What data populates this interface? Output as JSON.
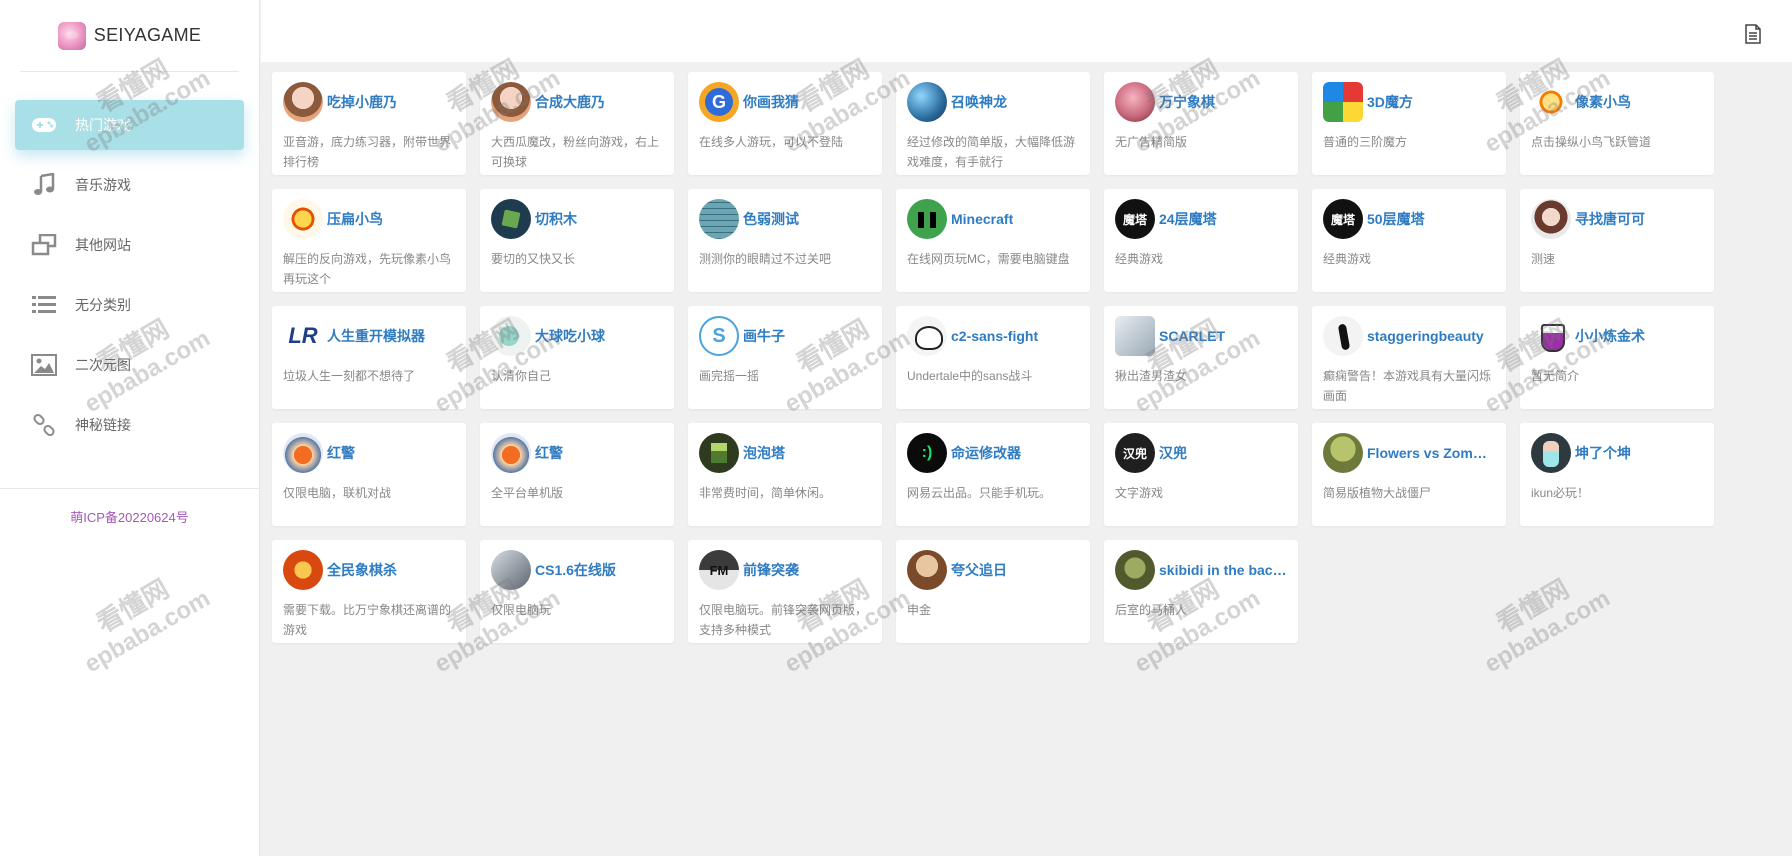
{
  "brand": {
    "name": "SEIYAGAME"
  },
  "menu": [
    {
      "label": "热门游戏",
      "icon": "gamepad-icon",
      "active": true
    },
    {
      "label": "音乐游戏",
      "icon": "music-note-icon",
      "active": false
    },
    {
      "label": "其他网站",
      "icon": "windows-icon",
      "active": false
    },
    {
      "label": "无分类别",
      "icon": "list-icon",
      "active": false
    },
    {
      "label": "二次元图",
      "icon": "image-icon",
      "active": false
    },
    {
      "label": "神秘链接",
      "icon": "link-icon",
      "active": false
    }
  ],
  "footer": {
    "icp": "萌ICP备20220624号"
  },
  "topbar": {
    "icon": "document-icon"
  },
  "cards": [
    {
      "title": "吃掉小鹿乃",
      "desc": "亚音游，底力练习器，附带世界排行榜",
      "avatar": "av-kid",
      "avatar_text": ""
    },
    {
      "title": "合成大鹿乃",
      "desc": "大西瓜魔改，粉丝向游戏，右上可换球",
      "avatar": "av-kid",
      "avatar_text": ""
    },
    {
      "title": "你画我猜",
      "desc": "在线多人游玩，可以不登陆",
      "avatar": "av-g",
      "avatar_text": "G"
    },
    {
      "title": "召唤神龙",
      "desc": "经过修改的简单版，大幅降低游戏难度，有手就行",
      "avatar": "av-dragon",
      "avatar_text": ""
    },
    {
      "title": "万宁象棋",
      "desc": "无广告精简版",
      "avatar": "av-chess",
      "avatar_text": ""
    },
    {
      "title": "3D魔方",
      "desc": "普通的三阶魔方",
      "avatar": "av-cube",
      "avatar_text": ""
    },
    {
      "title": "像素小鸟",
      "desc": "点击操纵小鸟飞跃管道",
      "avatar": "av-bird",
      "avatar_text": ""
    },
    {
      "title": "压扁小鸟",
      "desc": "解压的反向游戏，先玩像素小鸟再玩这个",
      "avatar": "av-bird2",
      "avatar_text": ""
    },
    {
      "title": "切积木",
      "desc": "要切的又快又长",
      "avatar": "av-cut",
      "avatar_text": ""
    },
    {
      "title": "色弱测试",
      "desc": "测测你的眼睛过不过关吧",
      "avatar": "av-grid",
      "avatar_text": ""
    },
    {
      "title": "Minecraft",
      "desc": "在线网页玩MC，需要电脑键盘",
      "avatar": "av-mc",
      "avatar_text": ""
    },
    {
      "title": "24层魔塔",
      "desc": "经典游戏",
      "avatar": "av-black",
      "avatar_text": "魔塔"
    },
    {
      "title": "50层魔塔",
      "desc": "经典游戏",
      "avatar": "av-black",
      "avatar_text": "魔塔"
    },
    {
      "title": "寻找唐可可",
      "desc": "测速",
      "avatar": "av-girl",
      "avatar_text": ""
    },
    {
      "title": "人生重开模拟器",
      "desc": "垃圾人生一刻都不想待了",
      "avatar": "av-lr",
      "avatar_text": "LR"
    },
    {
      "title": "大球吃小球",
      "desc": "认清你自己",
      "avatar": "av-ball",
      "avatar_text": ""
    },
    {
      "title": "画牛子",
      "desc": "画完摇一摇",
      "avatar": "av-s",
      "avatar_text": "S"
    },
    {
      "title": "c2-sans-fight",
      "desc": "Undertale中的sans战斗",
      "avatar": "av-sans",
      "avatar_text": ""
    },
    {
      "title": "SCARLET",
      "desc": "揪出渣男渣女",
      "avatar": "av-scarlet",
      "avatar_text": ""
    },
    {
      "title": "staggeringbeauty",
      "desc": "癫痫警告！本游戏具有大量闪烁画面",
      "avatar": "av-stag",
      "avatar_text": ""
    },
    {
      "title": "小小炼金术",
      "desc": "暂无简介",
      "avatar": "av-flask",
      "avatar_text": ""
    },
    {
      "title": "红警",
      "desc": "仅限电脑，联机对战",
      "avatar": "av-red",
      "avatar_text": ""
    },
    {
      "title": "红警",
      "desc": "全平台单机版",
      "avatar": "av-red",
      "avatar_text": ""
    },
    {
      "title": "泡泡塔",
      "desc": "非常费时间，简单休闲。",
      "avatar": "av-pixel",
      "avatar_text": ""
    },
    {
      "title": "命运修改器",
      "desc": "网易云出品。只能手机玩。",
      "avatar": "av-smile",
      "avatar_text": ":)"
    },
    {
      "title": "汉兜",
      "desc": "文字游戏",
      "avatar": "av-hanzi",
      "avatar_text": "汉兜"
    },
    {
      "title": "Flowers vs Zombies",
      "desc": "简易版植物大战僵尸",
      "avatar": "av-zombie",
      "avatar_text": ""
    },
    {
      "title": "坤了个坤",
      "desc": "ikun必玩！",
      "avatar": "av-kun",
      "avatar_text": ""
    },
    {
      "title": "全民象棋杀",
      "desc": "需要下载。比万宁象棋还离谱的游戏",
      "avatar": "av-poker",
      "avatar_text": ""
    },
    {
      "title": "CS1.6在线版",
      "desc": "仅限电脑玩",
      "avatar": "av-cs",
      "avatar_text": ""
    },
    {
      "title": "前锋突袭",
      "desc": "仅限电脑玩。前锋突袭网页版，支持多种模式",
      "avatar": "av-front",
      "avatar_text": "FM"
    },
    {
      "title": "夸父追日",
      "desc": "申金",
      "avatar": "av-kuafu",
      "avatar_text": ""
    },
    {
      "title": "skibidi in the backrooms",
      "desc": "后室的马桶人",
      "avatar": "av-skib",
      "avatar_text": ""
    }
  ],
  "watermark": {
    "line1": "看懂网",
    "line2": "epbaba.com"
  }
}
